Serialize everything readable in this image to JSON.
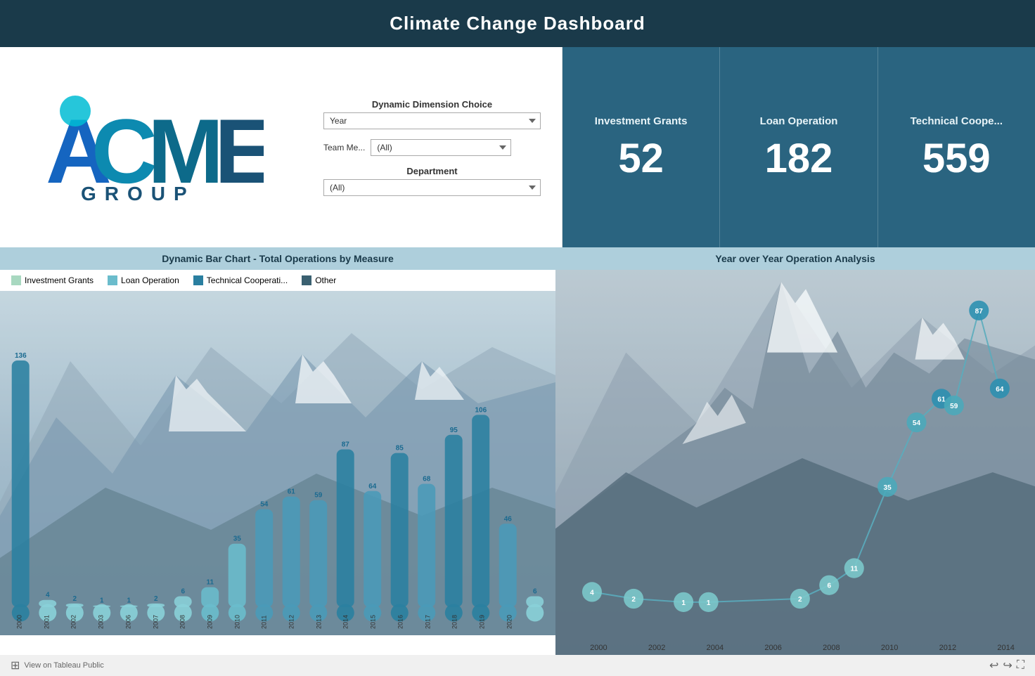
{
  "header": {
    "title": "Climate Change Dashboard"
  },
  "logo": {
    "text": "ACME GROUP"
  },
  "controls": {
    "dimension_label": "Dynamic Dimension Choice",
    "dimension_selected": "Year",
    "team_label": "Team Me...",
    "team_selected": "(All)",
    "department_label": "Department",
    "department_selected": "(All)"
  },
  "kpis": [
    {
      "label": "Investment Grants",
      "value": "52"
    },
    {
      "label": "Loan Operation",
      "value": "182"
    },
    {
      "label": "Technical Coope...",
      "value": "559"
    }
  ],
  "left_chart": {
    "title": "Dynamic Bar Chart - Total Operations by Measure",
    "legend": [
      {
        "label": "Investment Grants",
        "color": "#a8d8c0"
      },
      {
        "label": "Loan Operation",
        "color": "#6bbccc"
      },
      {
        "label": "Technical Cooperati...",
        "color": "#2a7fa0"
      },
      {
        "label": "Other",
        "color": "#3a6070"
      }
    ],
    "bar_numbers": [
      "136",
      "4",
      "2",
      "1",
      "1",
      "2",
      "6",
      "11",
      "35",
      "54",
      "61",
      "59",
      "87",
      "64",
      "85",
      "68",
      "95",
      "106",
      "46",
      "6"
    ],
    "x_labels": [
      "2000",
      "2001",
      "2002",
      "2003",
      "2006",
      "2007",
      "2008",
      "2009",
      "2010",
      "2011",
      "2012",
      "2013",
      "2014",
      "2015",
      "2016",
      "2017",
      "2018",
      "2019",
      "2020",
      ""
    ]
  },
  "right_chart": {
    "title": "Year over Year Operation Analysis",
    "points": [
      {
        "year": "2000",
        "value": 4
      },
      {
        "year": "2002",
        "value": 2
      },
      {
        "year": "2004",
        "value": 1
      },
      {
        "year": "2005",
        "value": 1
      },
      {
        "year": "2008",
        "value": 2
      },
      {
        "year": "2009",
        "value": 6
      },
      {
        "year": "2010",
        "value": 11
      },
      {
        "year": "2011",
        "value": 35
      },
      {
        "year": "2012",
        "value": 54
      },
      {
        "year": "2013",
        "value": 61
      },
      {
        "year": "2013b",
        "value": 59
      },
      {
        "year": "2014",
        "value": 87
      },
      {
        "year": "2014b",
        "value": 64
      }
    ],
    "x_labels": [
      "2000",
      "2002",
      "2004",
      "2006",
      "2008",
      "2010",
      "2012",
      "2014"
    ]
  },
  "footer": {
    "tableau_label": "View on Tableau Public"
  }
}
